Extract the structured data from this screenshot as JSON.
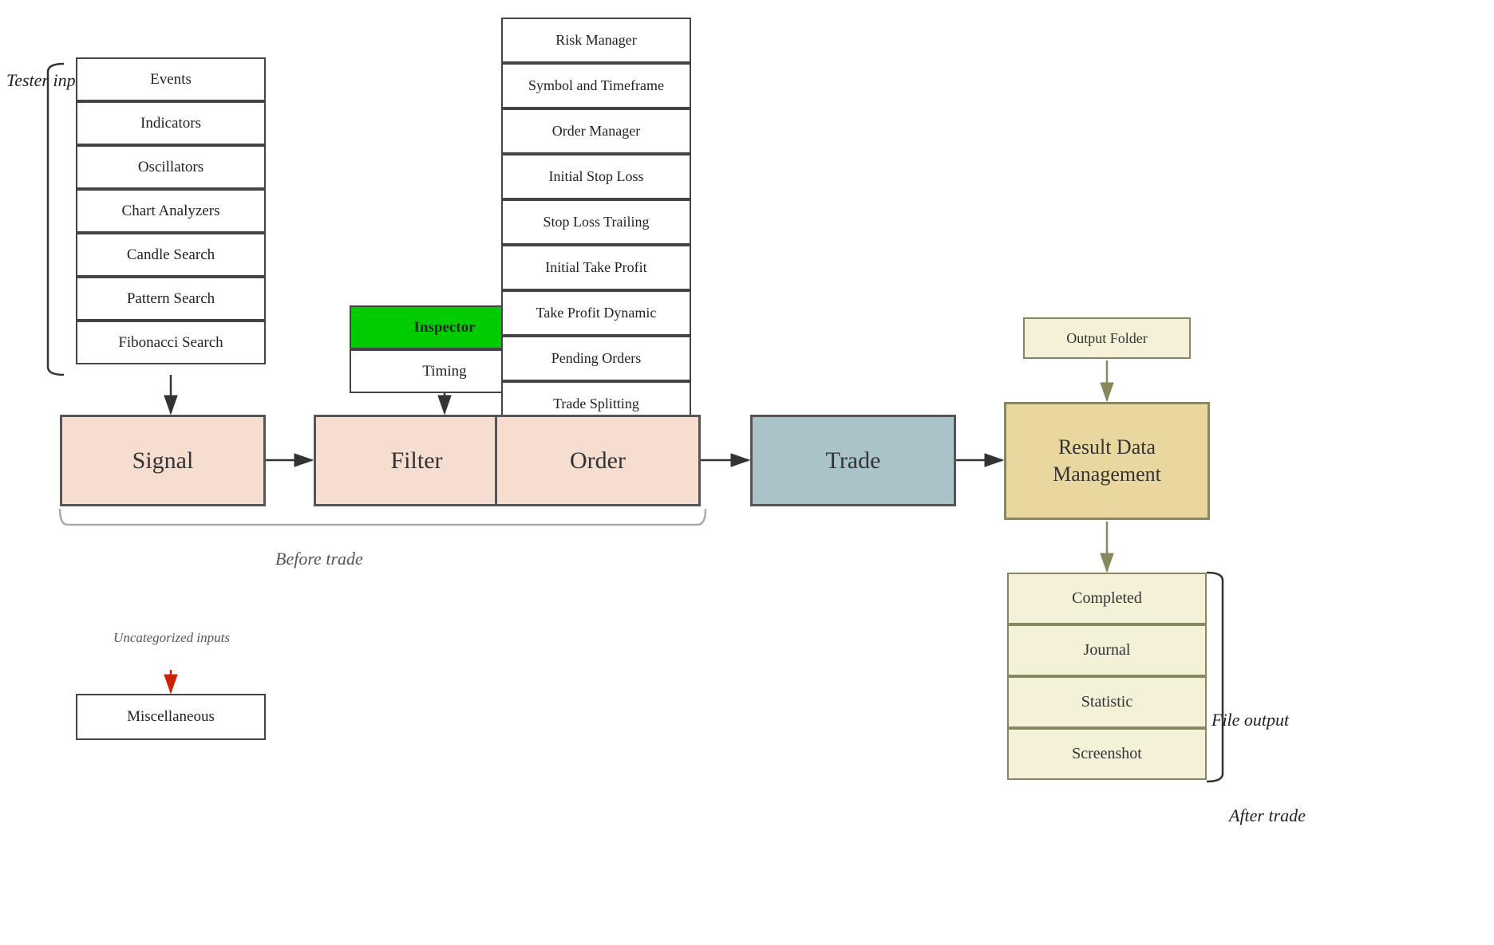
{
  "tester": {
    "label": "Tester input"
  },
  "signal_inputs": [
    {
      "label": "Events"
    },
    {
      "label": "Indicators"
    },
    {
      "label": "Oscillators"
    },
    {
      "label": "Chart Analyzers"
    },
    {
      "label": "Candle Search"
    },
    {
      "label": "Pattern Search"
    },
    {
      "label": "Fibonacci Search"
    }
  ],
  "filter_inputs": [
    {
      "label": "Inspector",
      "highlight": true
    },
    {
      "label": "Timing"
    }
  ],
  "order_inputs": [
    {
      "label": "Risk Manager"
    },
    {
      "label": "Symbol and Timeframe"
    },
    {
      "label": "Order Manager"
    },
    {
      "label": "Initial Stop Loss"
    },
    {
      "label": "Stop Loss Trailing"
    },
    {
      "label": "Initial Take Profit"
    },
    {
      "label": "Take Profit Dynamic"
    },
    {
      "label": "Pending Orders"
    },
    {
      "label": "Trade Splitting"
    }
  ],
  "flow": {
    "signal": "Signal",
    "filter": "Filter",
    "order": "Order",
    "trade": "Trade",
    "result": "Result Data\nManagement"
  },
  "output_folder": {
    "label": "Output Folder"
  },
  "file_outputs": [
    {
      "label": "Completed"
    },
    {
      "label": "Journal"
    },
    {
      "label": "Statistic"
    },
    {
      "label": "Screenshot"
    }
  ],
  "labels": {
    "file_output": "File output",
    "after_trade": "After trade",
    "before_trade": "Before trade",
    "uncategorized": "Uncategorized inputs",
    "miscellaneous": "Miscellaneous"
  }
}
